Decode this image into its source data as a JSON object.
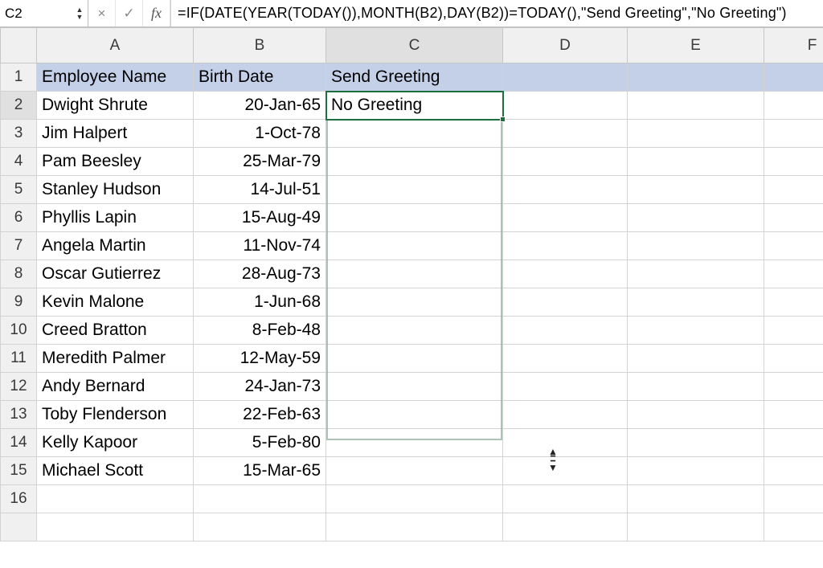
{
  "formula_bar": {
    "cell_ref": "C2",
    "cancel_glyph": "×",
    "accept_glyph": "✓",
    "fx_label": "fx",
    "formula": "=IF(DATE(YEAR(TODAY()),MONTH(B2),DAY(B2))=TODAY(),\"Send Greeting\",\"No Greeting\")"
  },
  "columns": [
    "A",
    "B",
    "C",
    "D",
    "E",
    "F"
  ],
  "row_numbers": [
    "1",
    "2",
    "3",
    "4",
    "5",
    "6",
    "7",
    "8",
    "9",
    "10",
    "11",
    "12",
    "13",
    "14",
    "15",
    "16"
  ],
  "active_cell": "C2",
  "header_row": {
    "A": "Employee Name",
    "B": "Birth Date",
    "C": "Send Greeting"
  },
  "rows": [
    {
      "A": "Dwight Shrute",
      "B": "20-Jan-65",
      "C": "No Greeting"
    },
    {
      "A": "Jim Halpert",
      "B": "1-Oct-78",
      "C": ""
    },
    {
      "A": "Pam Beesley",
      "B": "25-Mar-79",
      "C": ""
    },
    {
      "A": "Stanley Hudson",
      "B": "14-Jul-51",
      "C": ""
    },
    {
      "A": "Phyllis Lapin",
      "B": "15-Aug-49",
      "C": ""
    },
    {
      "A": "Angela Martin",
      "B": "11-Nov-74",
      "C": ""
    },
    {
      "A": "Oscar Gutierrez",
      "B": "28-Aug-73",
      "C": ""
    },
    {
      "A": "Kevin Malone",
      "B": "1-Jun-68",
      "C": ""
    },
    {
      "A": "Creed Bratton",
      "B": "8-Feb-48",
      "C": ""
    },
    {
      "A": "Meredith Palmer",
      "B": "12-May-59",
      "C": ""
    },
    {
      "A": "Andy Bernard",
      "B": "24-Jan-73",
      "C": ""
    },
    {
      "A": "Toby Flenderson",
      "B": "22-Feb-63",
      "C": ""
    },
    {
      "A": "Kelly Kapoor",
      "B": "5-Feb-80",
      "C": ""
    },
    {
      "A": "Michael Scott",
      "B": "15-Mar-65",
      "C": ""
    },
    {
      "A": "",
      "B": "",
      "C": ""
    }
  ]
}
